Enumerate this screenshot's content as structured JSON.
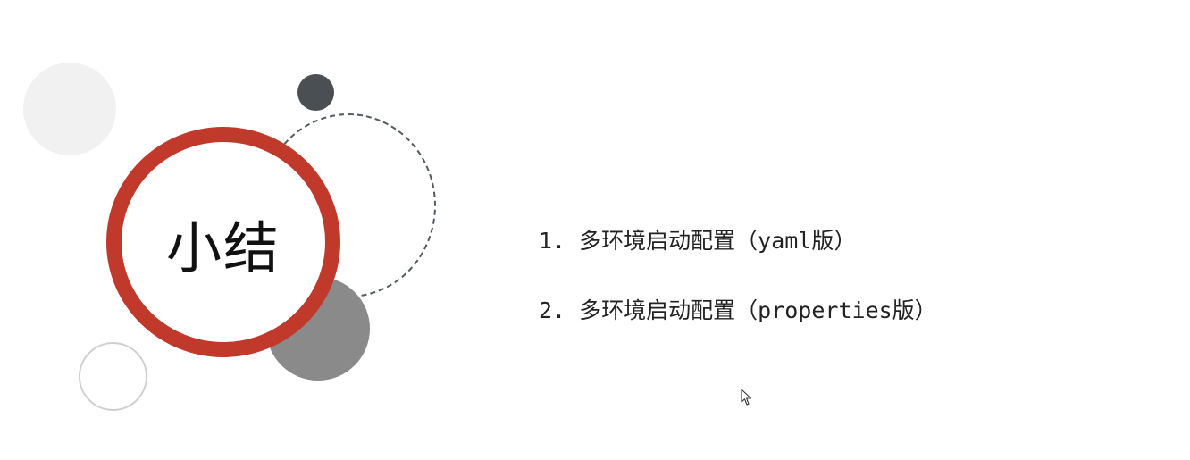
{
  "slide": {
    "title": "小结",
    "items": [
      "1. 多环境启动配置（yaml版）",
      "2. 多环境启动配置（properties版）"
    ]
  },
  "colors": {
    "accent_ring": "#c0392b",
    "dark_dot": "#4a4f54",
    "gray_circle": "#8a8a8a",
    "light_circle": "#f1f1f1",
    "outline_circle": "#cfcfcf"
  },
  "icons": {
    "cursor": "mouse-pointer-icon"
  }
}
